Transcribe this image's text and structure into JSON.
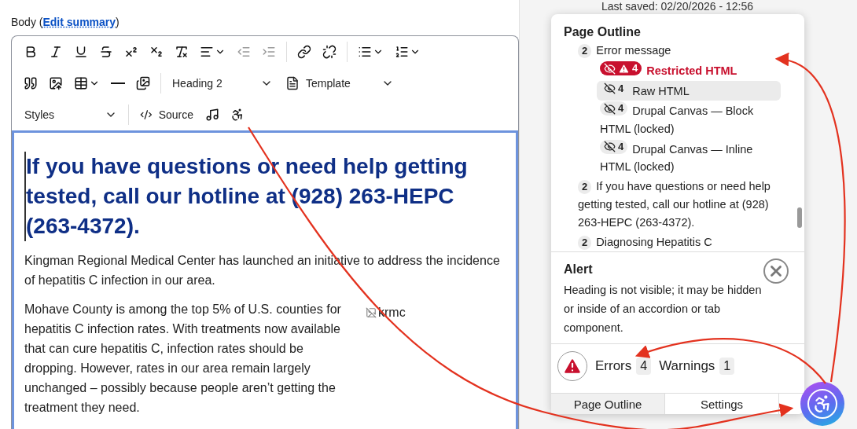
{
  "field_label": {
    "text": "Body (",
    "link": "Edit summary",
    "suffix": ")"
  },
  "toolbar": {
    "outdent": {
      "disabled": true
    },
    "indent": {
      "disabled": true
    },
    "heading_select": {
      "value": "Heading 2"
    },
    "template_select": {
      "value": "Template"
    },
    "styles_select": {
      "value": "Styles"
    },
    "source_button": {
      "label": "Source"
    }
  },
  "content": {
    "heading": "If you have questions or need help getting tested, call our hotline at (928) 263-HEPC (263-4372).",
    "paragraphs": [
      "Kingman Regional Medical Center has launched an initiative to address the incidence of hepatitis C infection in our area.",
      "Mohave County is among the top 5% of U.S. counties for hepatitis C infection rates. With treatments now available that can cure hepatitis C, infection rates should be dropping. However, rates in our area remain largely unchanged – possibly because people aren’t getting the treatment they need."
    ],
    "image_alt": "krmc"
  },
  "last_saved": "Last saved: 02/20/2026 - 12:56",
  "outline": {
    "title": "Page Outline",
    "items": [
      {
        "level": "2",
        "text": "Error message",
        "hidden": false,
        "error": false,
        "selected": false,
        "children": [
          {
            "level": "4",
            "text": "Restricted HTML",
            "hidden": true,
            "error": true,
            "selected": false
          },
          {
            "level": "4",
            "text": "Raw HTML",
            "hidden": true,
            "error": false,
            "selected": true
          },
          {
            "level": "4",
            "text": "Drupal Canvas — Block HTML (locked)",
            "hidden": true,
            "error": false,
            "selected": false
          },
          {
            "level": "4",
            "text": "Drupal Canvas — Inline HTML (locked)",
            "hidden": true,
            "error": false,
            "selected": false
          }
        ]
      },
      {
        "level": "2",
        "text": "If you have questions or need help getting tested, call our hotline at (928) 263-HEPC (263-4372).",
        "hidden": false,
        "error": false,
        "selected": false
      },
      {
        "level": "2",
        "text": "Diagnosing Hepatitis C",
        "hidden": false,
        "error": false,
        "selected": false
      }
    ]
  },
  "alert": {
    "title": "Alert",
    "message": "Heading is not visible; it may be hidden or inside of an accordion or tab component."
  },
  "counts": [
    {
      "label": "Errors",
      "count": "4"
    },
    {
      "label": "Warnings",
      "count": "1"
    }
  ],
  "tabs": [
    {
      "label": "Page Outline",
      "selected": true
    },
    {
      "label": "Settings",
      "selected": false
    }
  ]
}
